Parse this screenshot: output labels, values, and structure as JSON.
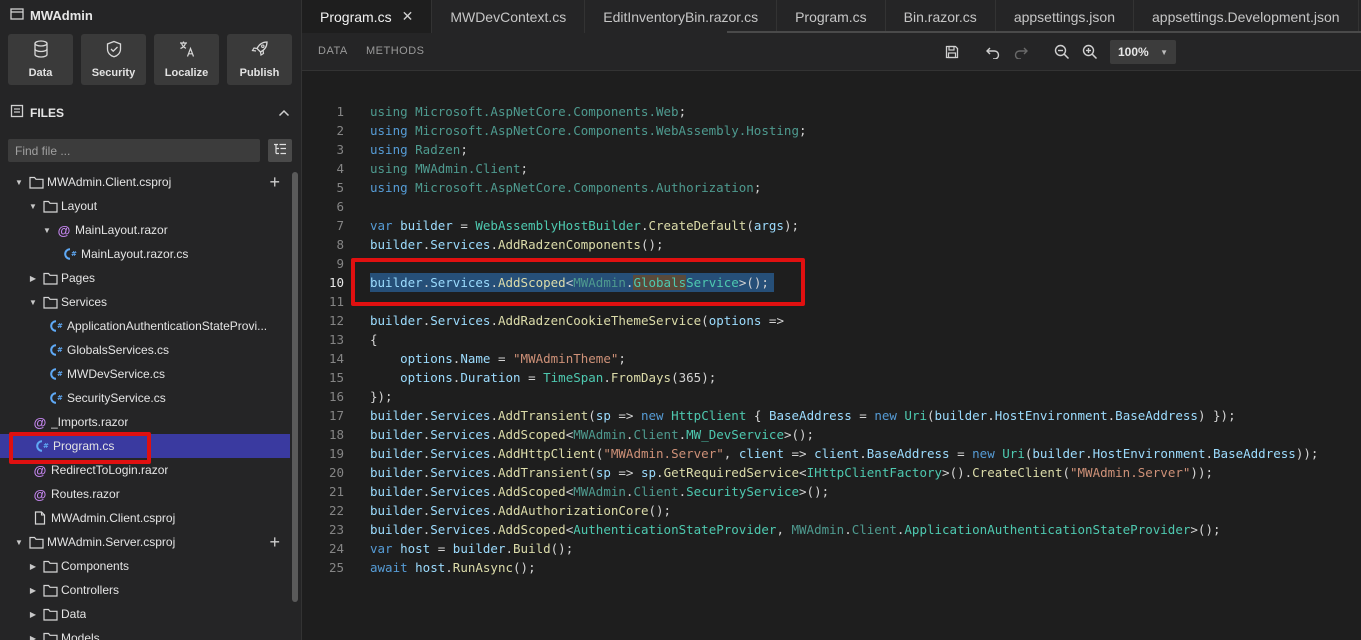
{
  "app": {
    "title": "MWAdmin"
  },
  "tools": [
    {
      "label": "Data",
      "icon": "database-icon"
    },
    {
      "label": "Security",
      "icon": "shield-icon"
    },
    {
      "label": "Localize",
      "icon": "translate-icon"
    },
    {
      "label": "Publish",
      "icon": "rocket-icon"
    }
  ],
  "files": {
    "header": "FILES",
    "find_placeholder": "Find file ..."
  },
  "tree": [
    {
      "label": "MWAdmin.Client.csproj",
      "type": "folder",
      "level": 0,
      "expanded": true,
      "plus": true
    },
    {
      "label": "Layout",
      "type": "folder",
      "level": 1,
      "expanded": true
    },
    {
      "label": "MainLayout.razor",
      "type": "razor",
      "level": 2,
      "expanded": true
    },
    {
      "label": "MainLayout.razor.cs",
      "type": "cs",
      "level": 3
    },
    {
      "label": "Pages",
      "type": "folder",
      "level": 1,
      "expanded": false
    },
    {
      "label": "Services",
      "type": "folder",
      "level": 1,
      "expanded": true
    },
    {
      "label": "ApplicationAuthenticationStateProvi...",
      "type": "cs",
      "level": 2
    },
    {
      "label": "GlobalsServices.cs",
      "type": "cs",
      "level": 2
    },
    {
      "label": "MWDevService.cs",
      "type": "cs",
      "level": 2
    },
    {
      "label": "SecurityService.cs",
      "type": "cs",
      "level": 2
    },
    {
      "label": "_Imports.razor",
      "type": "razor",
      "level": 1
    },
    {
      "label": "Program.cs",
      "type": "cs",
      "level": 1,
      "selected": true
    },
    {
      "label": "RedirectToLogin.razor",
      "type": "razor",
      "level": 1
    },
    {
      "label": "Routes.razor",
      "type": "razor",
      "level": 1
    },
    {
      "label": "MWAdmin.Client.csproj",
      "type": "file",
      "level": 1
    },
    {
      "label": "MWAdmin.Server.csproj",
      "type": "folder",
      "level": 0,
      "expanded": true,
      "plus": true
    },
    {
      "label": "Components",
      "type": "folder",
      "level": 1,
      "expanded": false
    },
    {
      "label": "Controllers",
      "type": "folder",
      "level": 1,
      "expanded": false
    },
    {
      "label": "Data",
      "type": "folder",
      "level": 1,
      "expanded": false
    },
    {
      "label": "Models",
      "type": "folder",
      "level": 1,
      "expanded": false
    }
  ],
  "tabs": [
    {
      "label": "Program.cs",
      "active": true,
      "closable": true
    },
    {
      "label": "MWDevContext.cs"
    },
    {
      "label": "EditInventoryBin.razor.cs"
    },
    {
      "label": "Program.cs"
    },
    {
      "label": "Bin.razor.cs"
    },
    {
      "label": "appsettings.json"
    },
    {
      "label": "appsettings.Development.json"
    }
  ],
  "toolbar": {
    "data_label": "DATA",
    "methods_label": "METHODS",
    "zoom": "100%"
  },
  "editor": {
    "current_line": 10,
    "lines": [
      [
        [
          "dim",
          "using "
        ],
        [
          "dim",
          "Microsoft.AspNetCore.Components.Web"
        ],
        [
          "",
          "; "
        ]
      ],
      [
        [
          "kw",
          "using "
        ],
        [
          "dim",
          "Microsoft.AspNetCore.Components.WebAssembly.Hosting"
        ],
        [
          "",
          ";"
        ]
      ],
      [
        [
          "kw",
          "using "
        ],
        [
          "dim",
          "Radzen"
        ],
        [
          "",
          ";"
        ]
      ],
      [
        [
          "dim",
          "using "
        ],
        [
          "dim",
          "MWAdmin.Client"
        ],
        [
          "",
          ";"
        ]
      ],
      [
        [
          "kw",
          "using "
        ],
        [
          "dim",
          "Microsoft.AspNetCore.Components.Authorization"
        ],
        [
          "",
          ";"
        ]
      ],
      [],
      [
        [
          "kw",
          "var "
        ],
        [
          "pr",
          "builder"
        ],
        [
          "",
          " = "
        ],
        [
          "ty",
          "WebAssemblyHostBuilder"
        ],
        [
          "",
          "."
        ],
        [
          "fn",
          "CreateDefault"
        ],
        [
          "",
          "("
        ],
        [
          "pr",
          "args"
        ],
        [
          "",
          ");"
        ]
      ],
      [
        [
          "pr",
          "builder"
        ],
        [
          "",
          "."
        ],
        [
          "pr",
          "Services"
        ],
        [
          "",
          "."
        ],
        [
          "fn",
          "AddRadzenComponents"
        ],
        [
          "",
          "();"
        ]
      ],
      [],
      [
        [
          "pr",
          "builder"
        ],
        [
          "",
          "."
        ],
        [
          "pr",
          "Services"
        ],
        [
          "",
          "."
        ],
        [
          "fn",
          "AddScoped"
        ],
        [
          "",
          "<"
        ],
        [
          "dim",
          "MWAdmin"
        ],
        [
          "",
          "."
        ],
        [
          "hl",
          "Globals"
        ],
        [
          "ty",
          "Service"
        ],
        [
          "",
          ">();"
        ]
      ],
      [],
      [
        [
          "pr",
          "builder"
        ],
        [
          "",
          "."
        ],
        [
          "pr",
          "Services"
        ],
        [
          "",
          "."
        ],
        [
          "fn",
          "AddRadzenCookieThemeService"
        ],
        [
          "",
          "("
        ],
        [
          "pr",
          "options"
        ],
        [
          "",
          " =>"
        ]
      ],
      [
        [
          "",
          "{"
        ]
      ],
      [
        [
          "",
          "    "
        ],
        [
          "pr",
          "options"
        ],
        [
          "",
          "."
        ],
        [
          "pr",
          "Name"
        ],
        [
          "",
          " = "
        ],
        [
          "st",
          "\"MWAdminTheme\""
        ],
        [
          "",
          ";"
        ]
      ],
      [
        [
          "",
          "    "
        ],
        [
          "pr",
          "options"
        ],
        [
          "",
          "."
        ],
        [
          "pr",
          "Duration"
        ],
        [
          "",
          " = "
        ],
        [
          "ty",
          "TimeSpan"
        ],
        [
          "",
          "."
        ],
        [
          "fn",
          "FromDays"
        ],
        [
          "",
          "(365);"
        ]
      ],
      [
        [
          "",
          "});"
        ]
      ],
      [
        [
          "pr",
          "builder"
        ],
        [
          "",
          "."
        ],
        [
          "pr",
          "Services"
        ],
        [
          "",
          "."
        ],
        [
          "fn",
          "AddTransient"
        ],
        [
          "",
          "("
        ],
        [
          "pr",
          "sp"
        ],
        [
          "",
          " => "
        ],
        [
          "kw",
          "new "
        ],
        [
          "ty",
          "HttpClient"
        ],
        [
          "",
          " { "
        ],
        [
          "pr",
          "BaseAddress"
        ],
        [
          "",
          " = "
        ],
        [
          "kw",
          "new "
        ],
        [
          "ty",
          "Uri"
        ],
        [
          "",
          "("
        ],
        [
          "pr",
          "builder"
        ],
        [
          "",
          "."
        ],
        [
          "pr",
          "HostEnvironment"
        ],
        [
          "",
          "."
        ],
        [
          "pr",
          "BaseAddress"
        ],
        [
          "",
          ") });"
        ]
      ],
      [
        [
          "pr",
          "builder"
        ],
        [
          "",
          "."
        ],
        [
          "pr",
          "Services"
        ],
        [
          "",
          "."
        ],
        [
          "fn",
          "AddScoped"
        ],
        [
          "",
          "<"
        ],
        [
          "dim",
          "MWAdmin"
        ],
        [
          "",
          "."
        ],
        [
          "dim",
          "Client"
        ],
        [
          "",
          "."
        ],
        [
          "ty",
          "MW_DevService"
        ],
        [
          "",
          ">();"
        ]
      ],
      [
        [
          "pr",
          "builder"
        ],
        [
          "",
          "."
        ],
        [
          "pr",
          "Services"
        ],
        [
          "",
          "."
        ],
        [
          "fn",
          "AddHttpClient"
        ],
        [
          "",
          "("
        ],
        [
          "st",
          "\"MWAdmin.Server\""
        ],
        [
          "",
          ", "
        ],
        [
          "pr",
          "client"
        ],
        [
          "",
          " => "
        ],
        [
          "pr",
          "client"
        ],
        [
          "",
          "."
        ],
        [
          "pr",
          "BaseAddress"
        ],
        [
          "",
          " = "
        ],
        [
          "kw",
          "new "
        ],
        [
          "ty",
          "Uri"
        ],
        [
          "",
          "("
        ],
        [
          "pr",
          "builder"
        ],
        [
          "",
          "."
        ],
        [
          "pr",
          "HostEnvironment"
        ],
        [
          "",
          "."
        ],
        [
          "pr",
          "BaseAddress"
        ],
        [
          "",
          "));"
        ]
      ],
      [
        [
          "pr",
          "builder"
        ],
        [
          "",
          "."
        ],
        [
          "pr",
          "Services"
        ],
        [
          "",
          "."
        ],
        [
          "fn",
          "AddTransient"
        ],
        [
          "",
          "("
        ],
        [
          "pr",
          "sp"
        ],
        [
          "",
          " => "
        ],
        [
          "pr",
          "sp"
        ],
        [
          "",
          "."
        ],
        [
          "fn",
          "GetRequiredService"
        ],
        [
          "",
          "<"
        ],
        [
          "ty",
          "IHttpClientFactory"
        ],
        [
          "",
          ">()."
        ],
        [
          "fn",
          "CreateClient"
        ],
        [
          "",
          "("
        ],
        [
          "st",
          "\"MWAdmin.Server\""
        ],
        [
          "",
          "));"
        ]
      ],
      [
        [
          "pr",
          "builder"
        ],
        [
          "",
          "."
        ],
        [
          "pr",
          "Services"
        ],
        [
          "",
          "."
        ],
        [
          "fn",
          "AddScoped"
        ],
        [
          "",
          "<"
        ],
        [
          "dim",
          "MWAdmin"
        ],
        [
          "",
          "."
        ],
        [
          "dim",
          "Client"
        ],
        [
          "",
          "."
        ],
        [
          "ty",
          "SecurityService"
        ],
        [
          "",
          ">();"
        ]
      ],
      [
        [
          "pr",
          "builder"
        ],
        [
          "",
          "."
        ],
        [
          "pr",
          "Services"
        ],
        [
          "",
          "."
        ],
        [
          "fn",
          "AddAuthorizationCore"
        ],
        [
          "",
          "();"
        ]
      ],
      [
        [
          "pr",
          "builder"
        ],
        [
          "",
          "."
        ],
        [
          "pr",
          "Services"
        ],
        [
          "",
          "."
        ],
        [
          "fn",
          "AddScoped"
        ],
        [
          "",
          "<"
        ],
        [
          "ty",
          "AuthenticationStateProvider"
        ],
        [
          "",
          ", "
        ],
        [
          "dim",
          "MWAdmin"
        ],
        [
          "",
          "."
        ],
        [
          "dim",
          "Client"
        ],
        [
          "",
          "."
        ],
        [
          "ty",
          "ApplicationAuthenticationStateProvider"
        ],
        [
          "",
          ">();"
        ]
      ],
      [
        [
          "kw",
          "var "
        ],
        [
          "pr",
          "host"
        ],
        [
          "",
          " = "
        ],
        [
          "pr",
          "builder"
        ],
        [
          "",
          "."
        ],
        [
          "fn",
          "Build"
        ],
        [
          "",
          "();"
        ]
      ],
      [
        [
          "kw",
          "await "
        ],
        [
          "pr",
          "host"
        ],
        [
          "",
          "."
        ],
        [
          "fn",
          "RunAsync"
        ],
        [
          "",
          "();"
        ]
      ]
    ]
  },
  "colors": {
    "selection": "#264f78",
    "highlight_box": "#e01010",
    "tree_selected": "#3a3aa0"
  }
}
